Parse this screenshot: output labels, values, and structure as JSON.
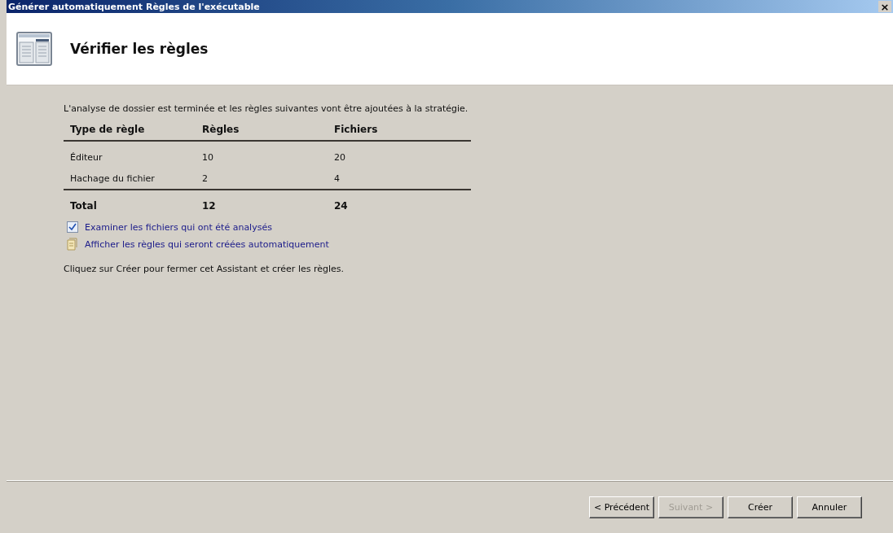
{
  "window": {
    "title": "Générer automatiquement Règles de l'exécutable",
    "close": "×"
  },
  "header": {
    "title": "Vérifier les règles"
  },
  "intro": "L'analyse de dossier est terminée et les règles suivantes vont être ajoutées à la stratégie.",
  "table": {
    "columns": [
      "Type de règle",
      "Règles",
      "Fichiers"
    ],
    "rows": [
      [
        "Éditeur",
        "10",
        "20"
      ],
      [
        "Hachage du fichier",
        "2",
        "4"
      ]
    ],
    "total": [
      "Total",
      "12",
      "24"
    ]
  },
  "links": [
    {
      "kind": "check",
      "label": "Examiner les fichiers qui ont été analysés"
    },
    {
      "kind": "document",
      "label": "Afficher les règles qui seront créées automatiquement"
    }
  ],
  "footer_text": "Cliquez sur Créer pour fermer cet Assistant et créer les règles.",
  "buttons": [
    {
      "label": "< Précédent",
      "disabled": false
    },
    {
      "label": "Suivant >",
      "disabled": true
    },
    {
      "label": "Créer",
      "disabled": false
    },
    {
      "label": "Annuler",
      "disabled": false
    }
  ]
}
